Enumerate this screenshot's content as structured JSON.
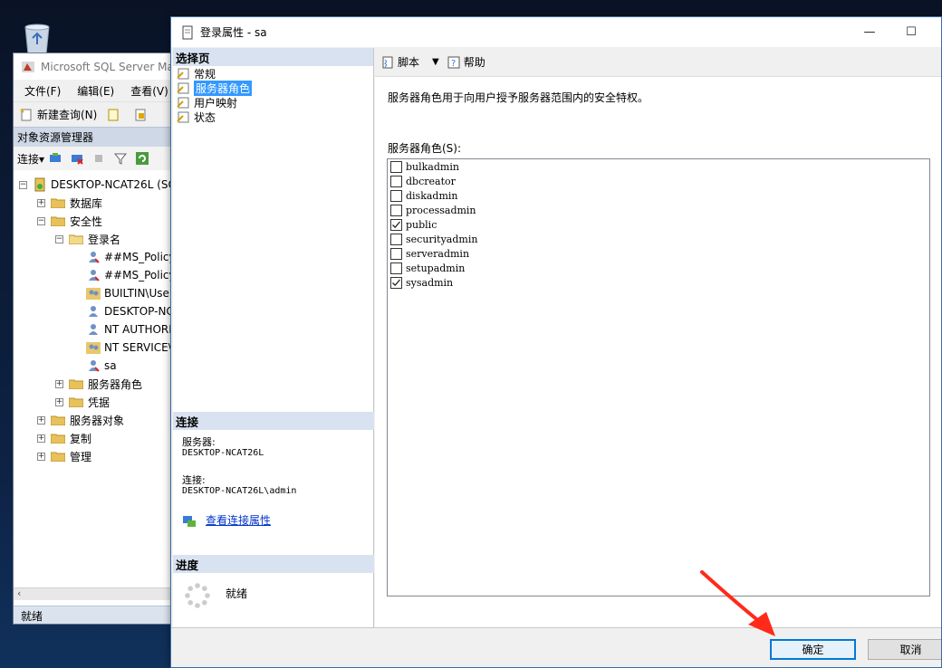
{
  "ssms": {
    "title": "Microsoft SQL Server Ma",
    "menu": [
      "文件(F)",
      "编辑(E)",
      "查看(V)"
    ],
    "toolbar_new_query": "新建查询(N)",
    "object_explorer_title": "对象资源管理器",
    "connect_label": "连接",
    "tree": {
      "server": "DESKTOP-NCAT26L (SQ",
      "databases": "数据库",
      "security": "安全性",
      "logins": "登录名",
      "login_items": [
        "##MS_Policy",
        "##MS_Policy",
        "BUILTIN\\Use",
        "DESKTOP-NC",
        "NT AUTHORI",
        "NT SERVICE\\",
        "sa"
      ],
      "server_roles": "服务器角色",
      "credentials": "凭据",
      "server_objects": "服务器对象",
      "replication": "复制",
      "management": "管理"
    },
    "status": "就绪"
  },
  "dialog": {
    "title": "登录属性 - sa",
    "select_page_header": "选择页",
    "pages": [
      "常规",
      "服务器角色",
      "用户映射",
      "状态"
    ],
    "selected_page": 1,
    "connection_header": "连接",
    "server_label": "服务器:",
    "server_value": "DESKTOP-NCAT26L",
    "connection_label": "连接:",
    "connection_value": "DESKTOP-NCAT26L\\admin",
    "view_connection_link": "查看连接属性",
    "progress_header": "进度",
    "progress_status": "就绪",
    "toolbar_script": "脚本",
    "toolbar_help": "帮助",
    "description": "服务器角色用于向用户授予服务器范围内的安全特权。",
    "roles_label": "服务器角色(S):",
    "roles": [
      {
        "name": "bulkadmin",
        "checked": false
      },
      {
        "name": "dbcreator",
        "checked": false
      },
      {
        "name": "diskadmin",
        "checked": false
      },
      {
        "name": "processadmin",
        "checked": false
      },
      {
        "name": "public",
        "checked": true
      },
      {
        "name": "securityadmin",
        "checked": false
      },
      {
        "name": "serveradmin",
        "checked": false
      },
      {
        "name": "setupadmin",
        "checked": false
      },
      {
        "name": "sysadmin",
        "checked": true
      }
    ],
    "ok_button": "确定",
    "cancel_button": "取消"
  },
  "colors": {
    "accent": "#0078d7",
    "selected_page_bg": "#3399ff",
    "section_header_bg": "#d8e2f0",
    "annotation_arrow": "#ff2a1a"
  }
}
